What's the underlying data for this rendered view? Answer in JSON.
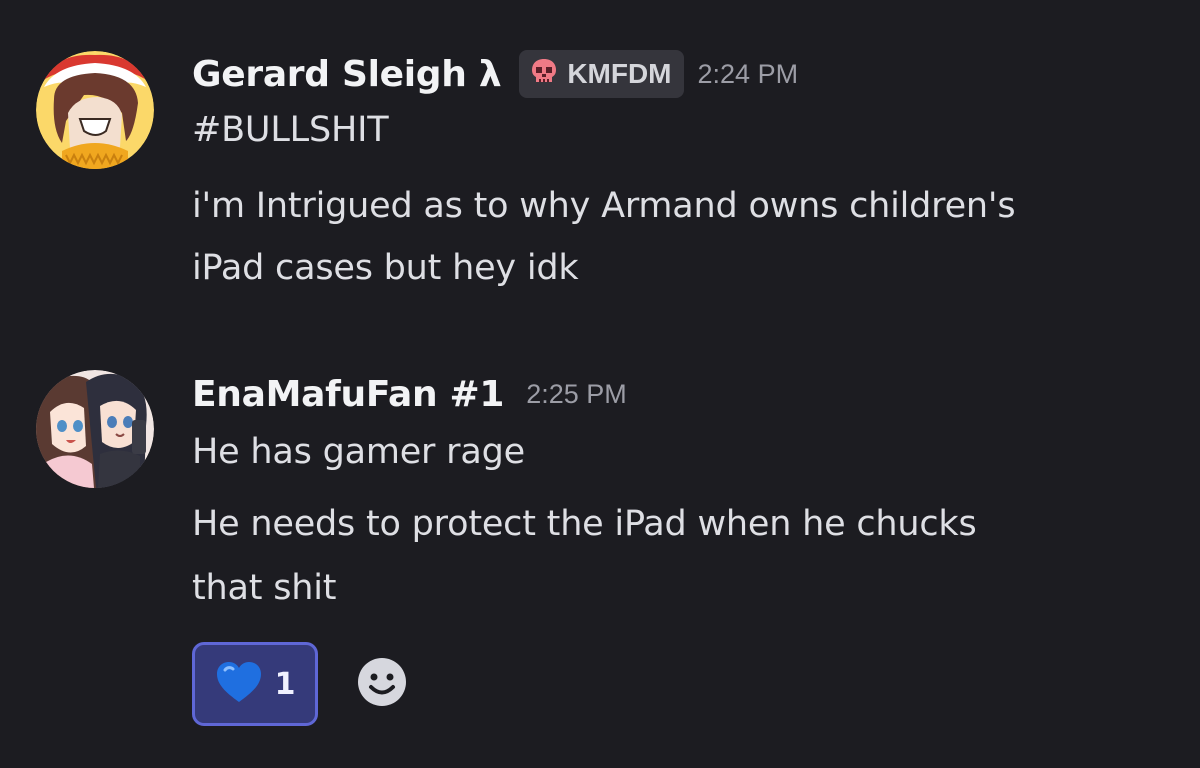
{
  "messages": [
    {
      "username": "Gerard Sleigh λ",
      "clan_tag": {
        "icon": "skull-icon",
        "label": "KMFDM"
      },
      "timestamp": "2:24 PM",
      "lines": [
        "#BULLSHIT",
        "i'm Intrigued as to why Armand owns children's",
        "iPad cases but hey idk"
      ]
    },
    {
      "username": "EnaMafuFan #1",
      "timestamp": "2:25 PM",
      "lines": [
        "He has gamer rage",
        "He needs to protect the iPad when he chucks",
        "that shit"
      ],
      "reactions": [
        {
          "emoji": "blue-heart-icon",
          "count": "1"
        }
      ],
      "add_reaction_icon": "smiley-icon"
    }
  ],
  "colors": {
    "background": "#1c1c21",
    "username": "#f2f3f5",
    "text": "#dedfe4",
    "timestamp": "#9c9da6",
    "reaction_bg": "#353a7a",
    "reaction_border": "#5f67d6"
  }
}
